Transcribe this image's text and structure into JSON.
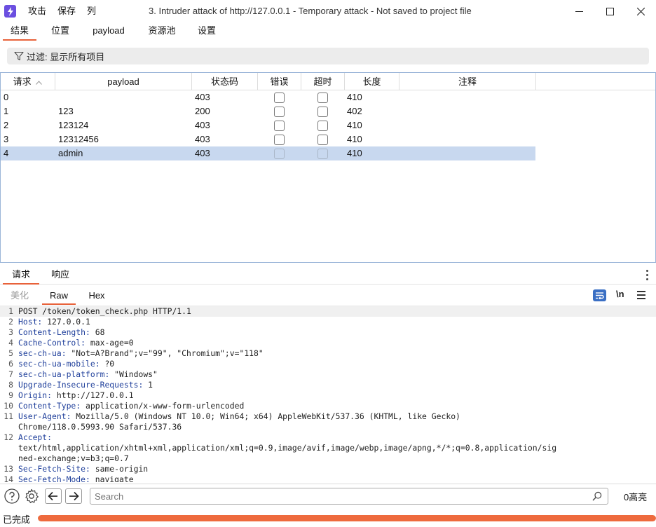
{
  "app": {
    "menu": [
      "攻击",
      "保存",
      "列"
    ],
    "window_title": "3. Intruder attack of http://127.0.0.1 - Temporary attack - Not saved to project file"
  },
  "main_tabs": [
    "结果",
    "位置",
    "payload",
    "资源池",
    "设置"
  ],
  "filter": {
    "label": "过滤: 显示所有项目"
  },
  "table": {
    "columns": [
      "请求",
      "payload",
      "状态码",
      "错误",
      "超时",
      "长度",
      "注释"
    ],
    "sort_indicator": "^",
    "rows": [
      {
        "request": "0",
        "payload": "",
        "status": "403",
        "error": false,
        "timeout": false,
        "length": "410",
        "comment": ""
      },
      {
        "request": "1",
        "payload": "123",
        "status": "200",
        "error": false,
        "timeout": false,
        "length": "402",
        "comment": ""
      },
      {
        "request": "2",
        "payload": "123124",
        "status": "403",
        "error": false,
        "timeout": false,
        "length": "410",
        "comment": ""
      },
      {
        "request": "3",
        "payload": "12312456",
        "status": "403",
        "error": false,
        "timeout": false,
        "length": "410",
        "comment": ""
      },
      {
        "request": "4",
        "payload": "admin",
        "status": "403",
        "error": false,
        "timeout": false,
        "length": "410",
        "comment": "",
        "selected": true
      }
    ]
  },
  "message_tabs": [
    "请求",
    "响应"
  ],
  "view_tabs": [
    "美化",
    "Raw",
    "Hex"
  ],
  "view_controls": {
    "newline_label": "\\n"
  },
  "editor": {
    "lines": [
      {
        "n": "1",
        "key": "",
        "text": "POST /token/token_check.php HTTP/1.1"
      },
      {
        "n": "2",
        "key": "Host:",
        "text": " 127.0.0.1"
      },
      {
        "n": "3",
        "key": "Content-Length:",
        "text": " 68"
      },
      {
        "n": "4",
        "key": "Cache-Control:",
        "text": " max-age=0"
      },
      {
        "n": "5",
        "key": "sec-ch-ua:",
        "text": " \"Not=A?Brand\";v=\"99\", \"Chromium\";v=\"118\""
      },
      {
        "n": "6",
        "key": "sec-ch-ua-mobile:",
        "text": " ?0"
      },
      {
        "n": "7",
        "key": "sec-ch-ua-platform:",
        "text": " \"Windows\""
      },
      {
        "n": "8",
        "key": "Upgrade-Insecure-Requests:",
        "text": " 1"
      },
      {
        "n": "9",
        "key": "Origin:",
        "text": " http://127.0.0.1"
      },
      {
        "n": "10",
        "key": "Content-Type:",
        "text": " application/x-www-form-urlencoded"
      },
      {
        "n": "11",
        "key": "User-Agent:",
        "text": " Mozilla/5.0 (Windows NT 10.0; Win64; x64) AppleWebKit/537.36 (KHTML, like Gecko)"
      },
      {
        "n": "",
        "key": "",
        "text": "Chrome/118.0.5993.90 Safari/537.36"
      },
      {
        "n": "12",
        "key": "Accept:",
        "text": ""
      },
      {
        "n": "",
        "key": "",
        "text": "text/html,application/xhtml+xml,application/xml;q=0.9,image/avif,image/webp,image/apng,*/*;q=0.8,application/sig"
      },
      {
        "n": "",
        "key": "",
        "text": "ned-exchange;v=b3;q=0.7"
      },
      {
        "n": "13",
        "key": "Sec-Fetch-Site:",
        "text": " same-origin"
      },
      {
        "n": "14",
        "key": "Sec-Fetch-Mode:",
        "text": " navigate"
      }
    ]
  },
  "search": {
    "placeholder": "Search",
    "match_count": "0高亮"
  },
  "status": {
    "text": "已完成",
    "progress": 1.0,
    "progress_color": "#ee6a3d"
  },
  "colors": {
    "accent": "#e8623a",
    "selection": "#c8d8ef",
    "header_key": "#1f3f9b",
    "wrap_button": "#3a6fc4"
  }
}
